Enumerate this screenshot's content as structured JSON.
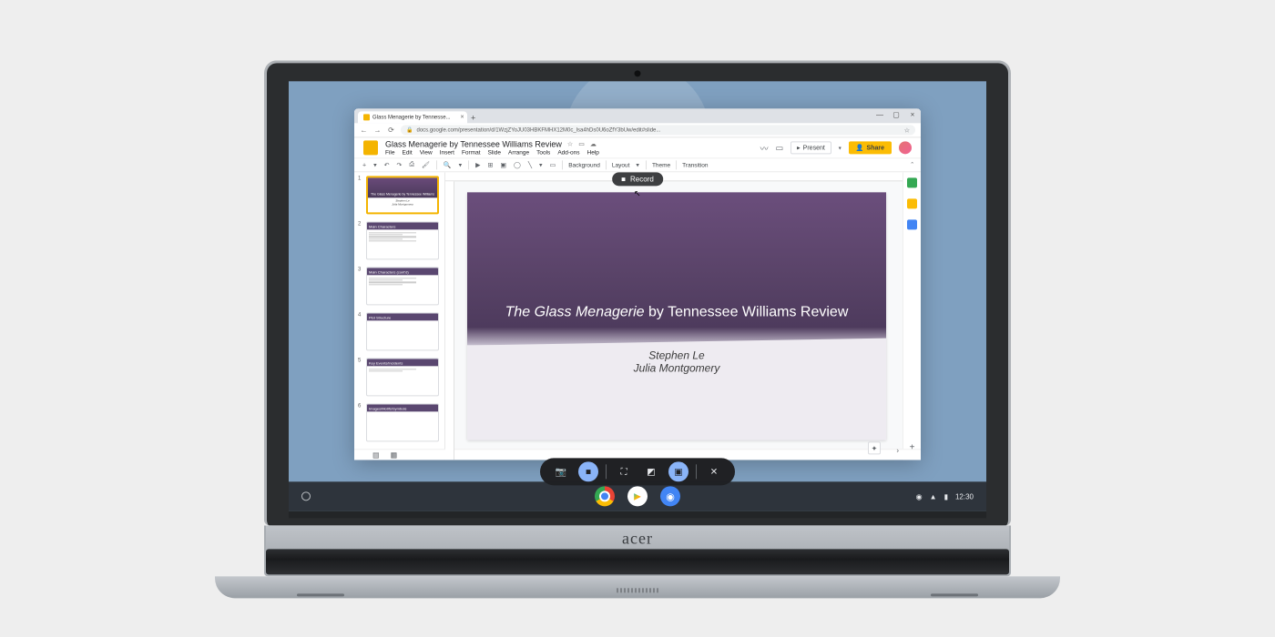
{
  "browser": {
    "tab_title": "Glass Menagerie by Tennesse...",
    "url": "docs.google.com/presentation/d/1WzjZYoJU03HBKFMHX12M0c_lsa4hDs0U6oZfY3bUw/edit#slide..."
  },
  "document": {
    "title": "Glass Menagerie by Tennessee Williams Review",
    "menus": [
      "File",
      "Edit",
      "View",
      "Insert",
      "Format",
      "Slide",
      "Arrange",
      "Tools",
      "Add-ons",
      "Help"
    ]
  },
  "titlebar": {
    "present": "Present",
    "share": "Share"
  },
  "toolbar": {
    "background": "Background",
    "layout": "Layout",
    "theme": "Theme",
    "transition": "Transition"
  },
  "thumbnails": [
    {
      "num": "1",
      "type": "title",
      "line1": "The Glass Menagerie by Tennessee Williams",
      "line2": "Stephen Le",
      "line3": "Julia Montgomery"
    },
    {
      "num": "2",
      "type": "content",
      "heading": "Main Characters"
    },
    {
      "num": "3",
      "type": "content",
      "heading": "Main Characters (cont'd)"
    },
    {
      "num": "4",
      "type": "content",
      "heading": "Plot Structure"
    },
    {
      "num": "5",
      "type": "content",
      "heading": "Key Events/Incidents"
    },
    {
      "num": "6",
      "type": "content",
      "heading": "Images/Motifs/Symbols"
    }
  ],
  "slide": {
    "title_italic": "The Glass Menagerie",
    "title_rest": " by Tennessee Williams Review",
    "author1": "Stephen Le",
    "author2": "Julia Montgomery"
  },
  "record_tooltip": "Record",
  "shelf": {
    "time": "12:30"
  },
  "laptop_brand": "acer"
}
